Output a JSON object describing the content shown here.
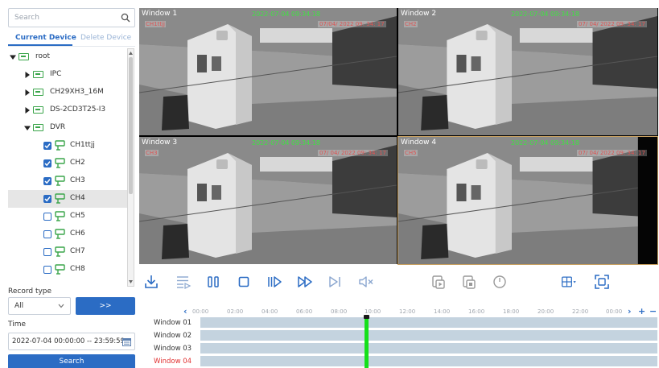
{
  "search": {
    "placeholder": "Search"
  },
  "tabs": {
    "current": "Current Device",
    "delete": "Delete Device"
  },
  "tree": {
    "root": "root",
    "ipc": "IPC",
    "ch29": "CH29XH3_16M",
    "ds": "DS-2CD3T25-I3",
    "dvr": "DVR",
    "channels": [
      {
        "label": "CH1ttjj",
        "checked": true
      },
      {
        "label": "CH2",
        "checked": true
      },
      {
        "label": "CH3",
        "checked": true
      },
      {
        "label": "CH4",
        "checked": true
      },
      {
        "label": "CH5",
        "checked": false
      },
      {
        "label": "CH6",
        "checked": false
      },
      {
        "label": "CH7",
        "checked": false
      },
      {
        "label": "CH8",
        "checked": false
      }
    ]
  },
  "record_type": {
    "label": "Record type",
    "value": "All",
    "go_label": ">>"
  },
  "time": {
    "label": "Time",
    "value": "2022-07-04 00:00:00 -- 23:59:59"
  },
  "search_button": "Search",
  "windows": [
    {
      "title": "Window 1",
      "stamp": "2022-07-04 09:34:18",
      "osd_ch": "CH1ttjj",
      "osd_dt": "07/04/ 2022  09: 34: 17"
    },
    {
      "title": "Window 2",
      "stamp": "2022-07-04 09:34:18",
      "osd_ch": "CH2",
      "osd_dt": "07/ 04/ 2022  09: 34: 17"
    },
    {
      "title": "Window 3",
      "stamp": "2022-07-04 09:34:18",
      "osd_ch": "CH3",
      "osd_dt": "07/ 04/ 2022  09: 34: 17"
    },
    {
      "title": "Window 4",
      "stamp": "2022-07-04 09:34:18",
      "osd_ch": "CH5",
      "osd_dt": "07/ 04/ 2022  09: 34: 17"
    }
  ],
  "toolbar": {
    "icons": [
      "download-icon",
      "playlist-icon",
      "pause-icon",
      "stop-icon",
      "slow-icon",
      "fast-forward-icon",
      "step-icon",
      "mute-icon",
      "clip-icon",
      "copy-icon",
      "timer-icon",
      "layout-icon",
      "fullscreen-icon"
    ]
  },
  "timeline": {
    "ticks": [
      "00:00",
      "02:00",
      "04:00",
      "06:00",
      "08:00",
      "10:00",
      "12:00",
      "14:00",
      "16:00",
      "18:00",
      "20:00",
      "22:00",
      "00:00"
    ],
    "prev": "‹",
    "next": "›",
    "zoom_in": "+",
    "zoom_out": "−",
    "rows": [
      {
        "label": "Window 01",
        "alert": false
      },
      {
        "label": "Window 02",
        "alert": false
      },
      {
        "label": "Window 03",
        "alert": false
      },
      {
        "label": "Window 04",
        "alert": true
      }
    ]
  },
  "colors": {
    "accent": "#2b6cc4",
    "playhead": "#15e01a",
    "stamp": "#41e043",
    "alert": "#e03030",
    "track": "#c4d3df"
  }
}
